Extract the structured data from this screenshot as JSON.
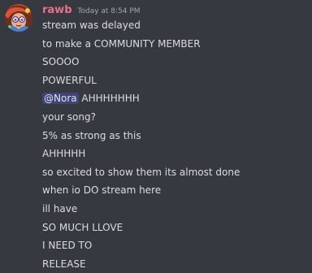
{
  "message": {
    "author": "rawb",
    "timestamp": "Today at 8:54 PM",
    "colors": {
      "author": "#e9718b",
      "mention_bg": "#5865f2",
      "background": "#36393f"
    },
    "lines": [
      {
        "text": "stream was delayed"
      },
      {
        "text": "to make a COMMUNITY MEMBER"
      },
      {
        "text": "SOOOO"
      },
      {
        "text": "POWERFUL"
      },
      {
        "mention": "@Nora",
        "text": " AHHHHHHH"
      },
      {
        "text": "your song?"
      },
      {
        "text": "5% as strong as this"
      },
      {
        "text": "AHHHHH"
      },
      {
        "text": "so excited to show them its almost done"
      },
      {
        "text": "when io DO stream here"
      },
      {
        "text": "ill have"
      },
      {
        "text": "SO MUCH LLOVE"
      },
      {
        "text": "I NEED TO"
      },
      {
        "text": "RELEASE"
      }
    ]
  }
}
